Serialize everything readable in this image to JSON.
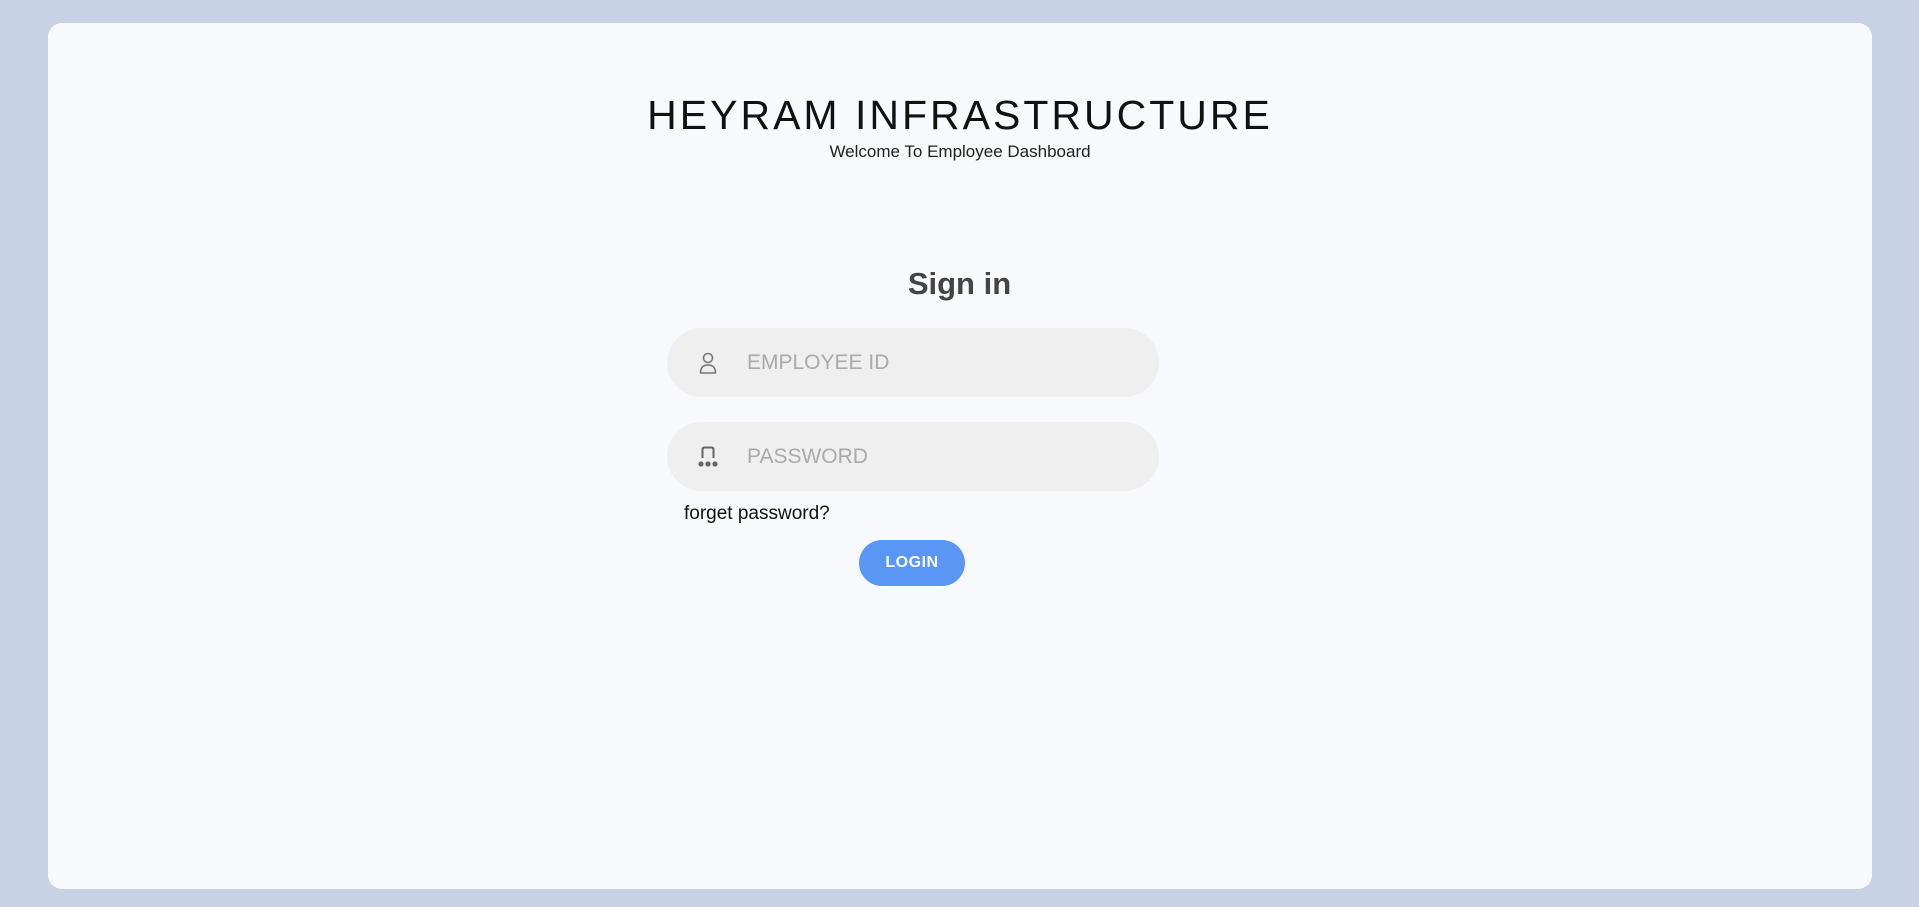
{
  "brand": {
    "title": "HEYRAM INFRASTRUCTURE",
    "subtitle": "Welcome To Employee Dashboard"
  },
  "signin": {
    "title": "Sign in",
    "employee_id": {
      "value": "",
      "placeholder": "EMPLOYEE ID",
      "icon": "user-icon"
    },
    "password": {
      "value": "",
      "placeholder": "PASSWORD",
      "icon": "password-icon"
    },
    "forgot_label": "forget password?",
    "login_label": "LOGIN"
  },
  "colors": {
    "background": "#c7d2e4",
    "card": "#f7f9fc",
    "field": "#efefef",
    "accent": "#5a96f5"
  }
}
